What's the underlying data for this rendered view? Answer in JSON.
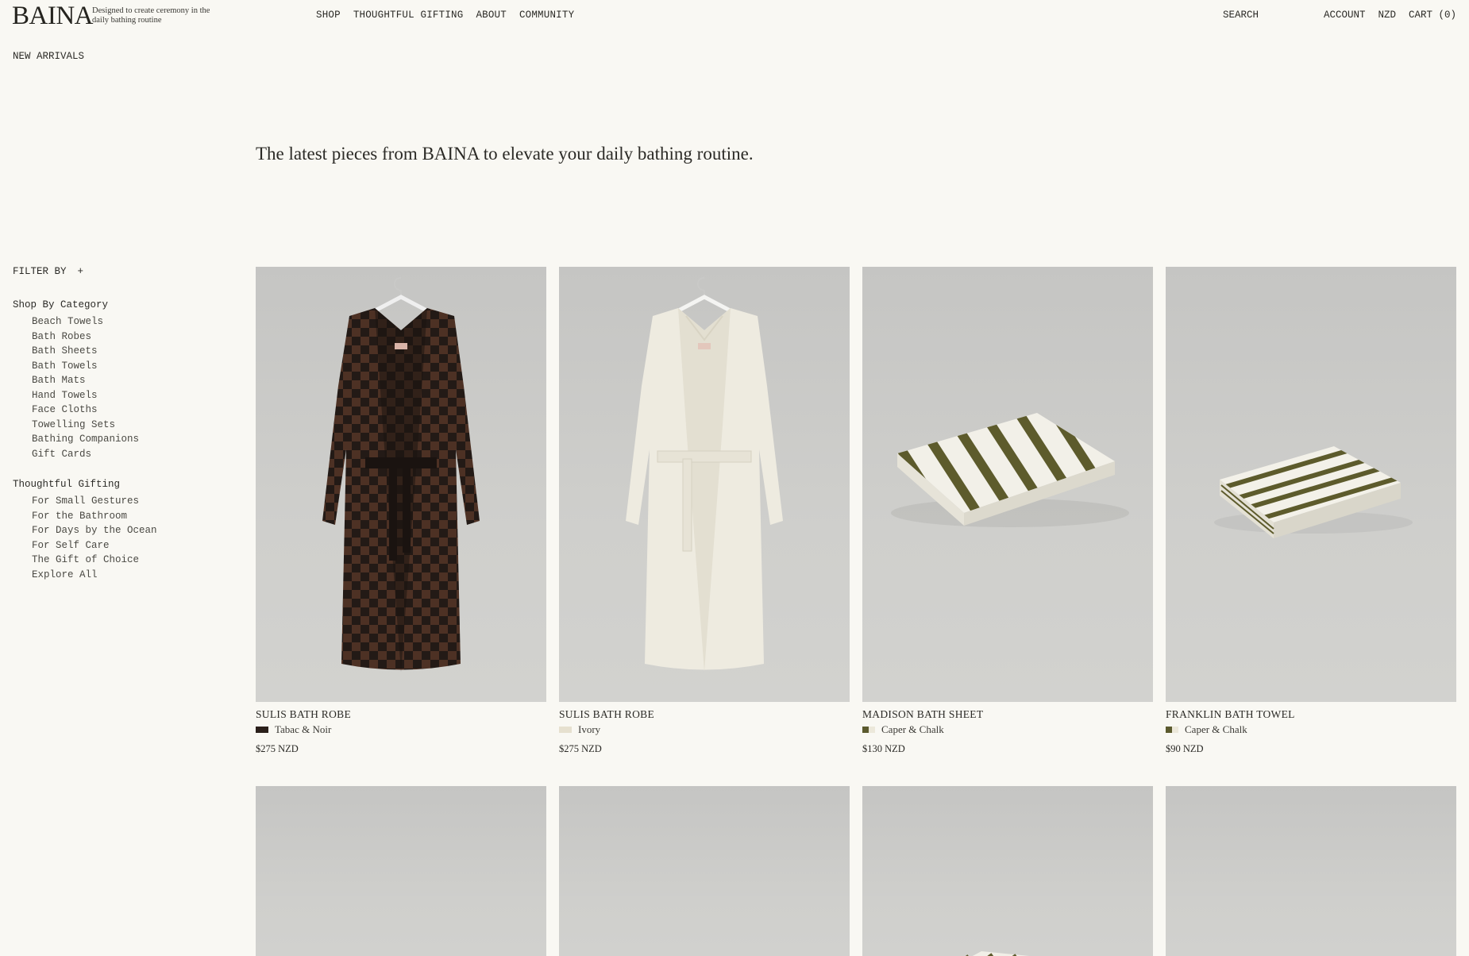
{
  "brand": {
    "logo": "BAINA",
    "tagline": "Designed to create ceremony in the daily bathing routine"
  },
  "nav": {
    "main": [
      "SHOP",
      "THOUGHTFUL GIFTING",
      "ABOUT",
      "COMMUNITY"
    ],
    "search": "SEARCH",
    "account": "ACCOUNT",
    "currency": "NZD",
    "cart": "CART (0)"
  },
  "page": {
    "label": "NEW ARRIVALS",
    "intro": "The latest pieces from BAINA to elevate your daily bathing routine."
  },
  "sidebar": {
    "filter_label": "FILTER BY",
    "filter_icon": "+",
    "groups": [
      {
        "title": "Shop By Category",
        "items": [
          "Beach Towels",
          "Bath Robes",
          "Bath Sheets",
          "Bath Towels",
          "Bath Mats",
          "Hand Towels",
          "Face Cloths",
          "Towelling Sets",
          "Bathing Companions",
          "Gift Cards"
        ]
      },
      {
        "title": "Thoughtful Gifting",
        "items": [
          "For Small Gestures",
          "For the Bathroom",
          "For Days by the Ocean",
          "For Self Care",
          "The Gift of Choice",
          "Explore All"
        ]
      }
    ]
  },
  "products": [
    {
      "name": "SULIS BATH ROBE",
      "color": "Tabac & Noir",
      "price": "$275 NZD",
      "swatch": [
        "#2a1f1a",
        "#2a1f1a"
      ],
      "image": "checkered-robe"
    },
    {
      "name": "SULIS BATH ROBE",
      "color": "Ivory",
      "price": "$275 NZD",
      "swatch": [
        "#e6e0cf",
        "#e6e0cf"
      ],
      "image": "ivory-robe"
    },
    {
      "name": "MADISON BATH SHEET",
      "color": "Caper & Chalk",
      "price": "$130 NZD",
      "swatch": [
        "#5b5a2e",
        "#ece8da"
      ],
      "image": "striped-sheet"
    },
    {
      "name": "FRANKLIN BATH TOWEL",
      "color": "Caper & Chalk",
      "price": "$90 NZD",
      "swatch": [
        "#5b5a2e",
        "#ece8da"
      ],
      "image": "striped-towel"
    }
  ],
  "products_row2": [
    {
      "image": "product-image"
    },
    {
      "image": "product-image"
    },
    {
      "image": "product-image"
    },
    {
      "image": "product-image"
    }
  ]
}
